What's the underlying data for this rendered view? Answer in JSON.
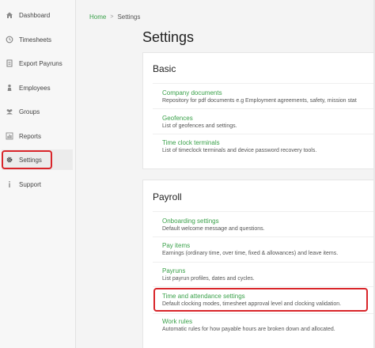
{
  "sidebar": {
    "items": [
      {
        "label": "Dashboard",
        "icon": "home-icon"
      },
      {
        "label": "Timesheets",
        "icon": "clock-icon"
      },
      {
        "label": "Export Payruns",
        "icon": "document-icon"
      },
      {
        "label": "Employees",
        "icon": "person-icon"
      },
      {
        "label": "Groups",
        "icon": "group-icon"
      },
      {
        "label": "Reports",
        "icon": "chart-icon"
      },
      {
        "label": "Settings",
        "icon": "gear-icon",
        "active": true
      },
      {
        "label": "Support",
        "icon": "info-icon"
      }
    ]
  },
  "breadcrumb": {
    "home": "Home",
    "separator": ">",
    "current": "Settings"
  },
  "page": {
    "title": "Settings"
  },
  "basic": {
    "title": "Basic",
    "items": [
      {
        "label": "Company documents",
        "description": "Repository for pdf documents e.g Employment agreements, safety, mission stat"
      },
      {
        "label": "Geofences",
        "description": "List of geofences and settings."
      },
      {
        "label": "Time clock terminals",
        "description": "List of timeclock terminals and device password recovery tools."
      }
    ]
  },
  "payroll": {
    "title": "Payroll",
    "items": [
      {
        "label": "Onboarding settings",
        "description": "Default welcome message and questions."
      },
      {
        "label": "Pay items",
        "description": "Earnings (ordinary time, over time, fixed & allowances) and leave items."
      },
      {
        "label": "Payruns",
        "description": "List payrun profiles, dates and cycles."
      },
      {
        "label": "Time and attendance settings",
        "description": "Default clocking modes, timesheet approval level and clocking validation."
      },
      {
        "label": "Work rules",
        "description": "Automatic rules for how payable hours are broken down and allocated."
      }
    ]
  },
  "colors": {
    "accent": "#3aa14a",
    "highlight": "#d9252a"
  }
}
